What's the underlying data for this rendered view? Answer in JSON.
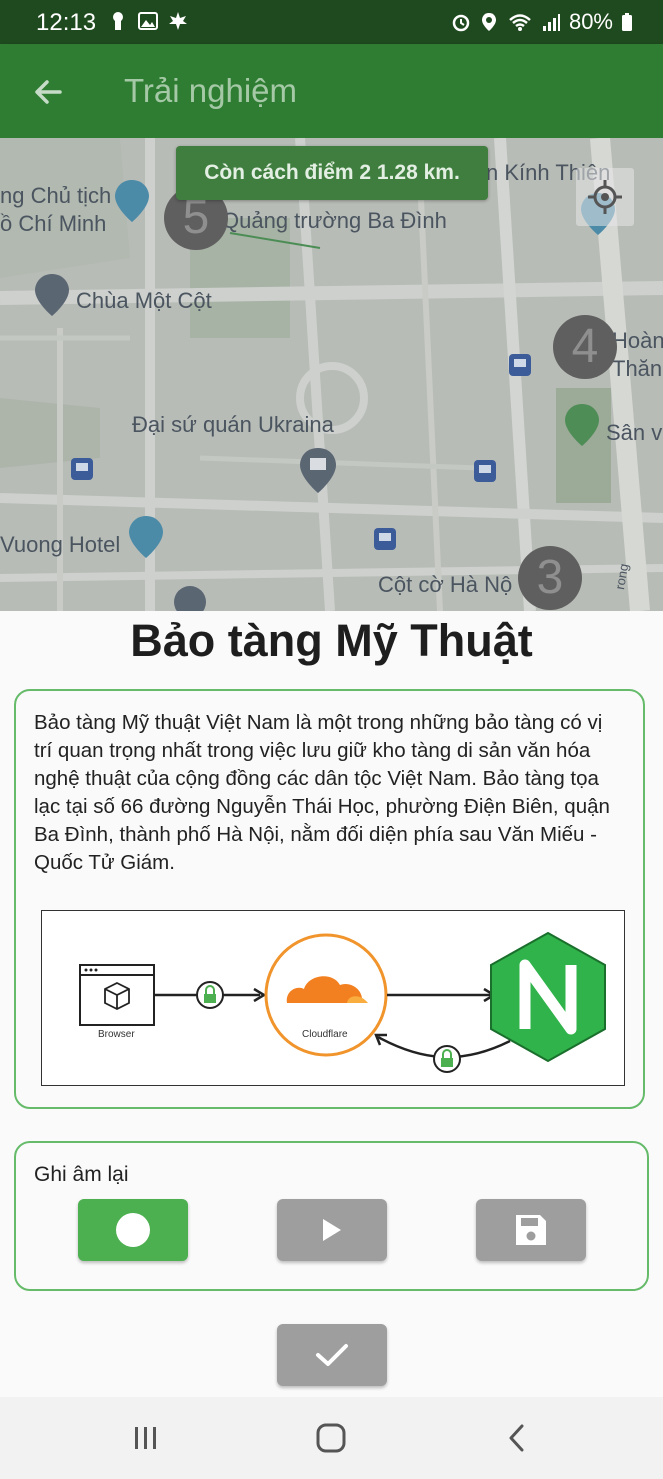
{
  "status_bar": {
    "time": "12:13",
    "battery": "80%"
  },
  "app_bar": {
    "title": "Trải nghiệm"
  },
  "map": {
    "distance_message": "Còn cách điểm 2 1.28 km.",
    "labels": {
      "ho_chi_minh_line1": "ng Chủ tịch",
      "ho_chi_minh_line2": "ồ Chí Minh",
      "quang_truong": "Quảng trường Ba Đình",
      "kinh_thien": "n Kính Thiên",
      "chua_mot_cot": "Chùa Một Cột",
      "hoang_thanh_line1": "Hoàn",
      "hoang_thanh_line2": "Thăn",
      "dai_su_quan": "Đại sứ quán Ukraina",
      "san_v": "Sân v",
      "hotel": "Vuong Hotel",
      "cot_co": "Cột cờ Hà Nộ",
      "street": "rong"
    },
    "markers": [
      "5",
      "4",
      "3"
    ]
  },
  "place": {
    "title": "Bảo tàng Mỹ Thuật",
    "description": "Bảo tàng Mỹ thuật Việt Nam là một trong những bảo tàng có vị trí quan trọng nhất trong việc lưu giữ kho tàng di sản văn hóa nghệ thuật của cộng đồng các dân tộc Việt Nam. Bảo tàng tọa lạc tại số 66 đường Nguyễn Thái Học, phường Điện Biên, quận Ba Đình, thành phố Hà Nội, nằm đối diện phía sau Văn Miếu - Quốc Tử Giám.",
    "figure": {
      "browser_label": "Browser",
      "cloudflare_label": "Cloudflare"
    }
  },
  "recording": {
    "label": "Ghi âm lại"
  },
  "colors": {
    "primary_dark": "#1f4a1f",
    "primary": "#2e7d32",
    "accent_green": "#4caf50",
    "button_gray": "#9e9e9e"
  }
}
